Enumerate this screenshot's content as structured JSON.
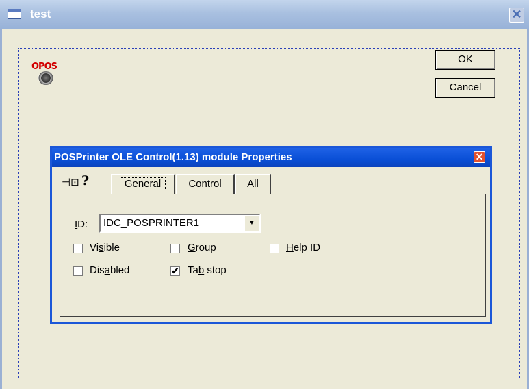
{
  "window": {
    "title": "test",
    "close_glyph": "✕"
  },
  "logo": {
    "text": "OPOS",
    "color": "#d20000"
  },
  "buttons": {
    "ok": "OK",
    "cancel": "Cancel"
  },
  "dialog": {
    "title": "POSPrinter OLE Control(1.13) module Properties",
    "close_glyph": "✕",
    "toolbar": {
      "pin_glyph": "⊣⊡",
      "help_glyph": "?"
    },
    "tabs": [
      {
        "label": "General",
        "selected": true
      },
      {
        "label": "Control",
        "selected": false
      },
      {
        "label": "All",
        "selected": false
      }
    ],
    "id_field": {
      "label_prefix": "",
      "label_mnemonic": "I",
      "label_suffix": "D:",
      "value": "IDC_POSPRINTER1",
      "arrow_glyph": "▼"
    },
    "checkboxes": [
      {
        "pre": "Vi",
        "mn": "s",
        "post": "ible",
        "checked": false
      },
      {
        "pre": "",
        "mn": "G",
        "post": "roup",
        "checked": false
      },
      {
        "pre": "",
        "mn": "H",
        "post": "elp ID",
        "checked": false
      },
      {
        "pre": "Dis",
        "mn": "a",
        "post": "bled",
        "checked": false
      },
      {
        "pre": "Ta",
        "mn": "b",
        "post": " stop",
        "checked": true
      }
    ],
    "check_glyph": "✔"
  },
  "colors": {
    "dialog_title_bar": "#0a4fd6",
    "outer_title_bar": "#a9c0e0",
    "face": "#ecead8"
  }
}
